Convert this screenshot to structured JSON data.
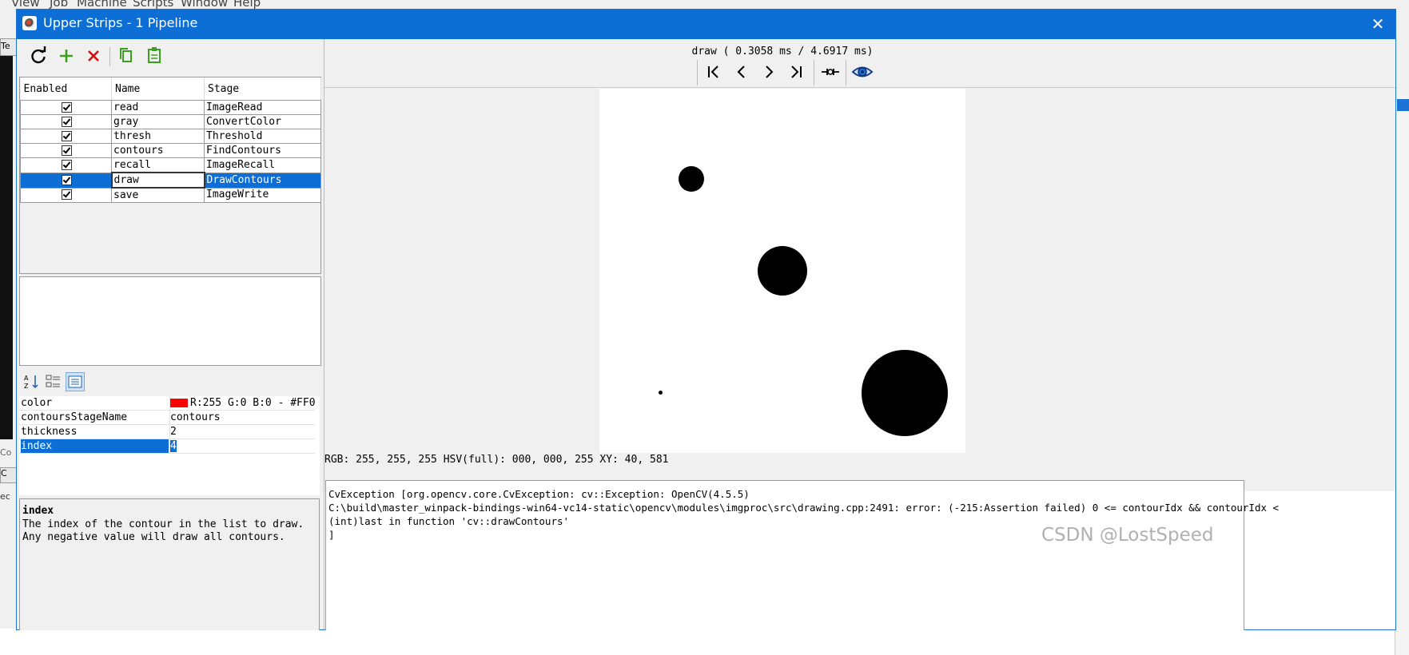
{
  "background_app": {
    "menu": [
      "View",
      "Job",
      "Machine",
      "Scripts",
      "Window",
      "Help"
    ],
    "left_edge_fragments": [
      "Te",
      "Co",
      "C",
      "ec"
    ]
  },
  "window": {
    "title": "Upper Strips - 1 Pipeline",
    "close_icon": "close-icon"
  },
  "toolbar": {
    "items": [
      {
        "icon": "refresh-icon"
      },
      {
        "icon": "add-icon"
      },
      {
        "icon": "delete-icon"
      },
      {
        "icon": "copy-icon"
      },
      {
        "icon": "paste-icon"
      }
    ]
  },
  "pipeline": {
    "columns": [
      "Enabled",
      "Name",
      "Stage"
    ],
    "rows": [
      {
        "enabled": true,
        "name": "read",
        "stage": "ImageRead"
      },
      {
        "enabled": true,
        "name": "gray",
        "stage": "ConvertColor"
      },
      {
        "enabled": true,
        "name": "thresh",
        "stage": "Threshold"
      },
      {
        "enabled": true,
        "name": "contours",
        "stage": "FindContours"
      },
      {
        "enabled": true,
        "name": "recall",
        "stage": "ImageRecall"
      },
      {
        "enabled": true,
        "name": "draw",
        "stage": "DrawContours",
        "selected": true
      },
      {
        "enabled": true,
        "name": "save",
        "stage": "ImageWrite"
      }
    ]
  },
  "properties": {
    "toolbar_icons": [
      "sort-alpha-icon",
      "categorized-icon",
      "description-icon"
    ],
    "rows": [
      {
        "name": "color",
        "value": "R:255 G:0 B:0 - #FF0..",
        "swatch": "#ff0000"
      },
      {
        "name": "contoursStageName",
        "value": "contours"
      },
      {
        "name": "thickness",
        "value": "2"
      },
      {
        "name": "index",
        "value": "4",
        "selected": true
      }
    ],
    "description": {
      "title": "index",
      "text": "The index of the contour in the list to draw. Any negative value will draw all contours."
    }
  },
  "viewer": {
    "stage_timing": "draw ( 0.3058 ms / 4.6917 ms)",
    "nav_icons": [
      "first-icon",
      "previous-icon",
      "next-icon",
      "last-icon",
      "break-icon",
      "view-eye-icon"
    ],
    "pixel_status": "RGB: 255, 255, 255 HSV(full): 000, 000, 255 XY: 40, 581"
  },
  "console": {
    "text": "CvException [org.opencv.core.CvException: cv::Exception: OpenCV(4.5.5)\nC:\\build\\master_winpack-bindings-win64-vc14-static\\opencv\\modules\\imgproc\\src\\drawing.cpp:2491: error: (-215:Assertion failed) 0 <= contourIdx && contourIdx <\n(int)last in function 'cv::drawContours'\n]"
  },
  "watermark": "CSDN @LostSpeed",
  "colors": {
    "accent": "#0d6fd6",
    "selection": "#0d6fd6",
    "add_green": "#3ca11a",
    "delete_red": "#d01010"
  }
}
